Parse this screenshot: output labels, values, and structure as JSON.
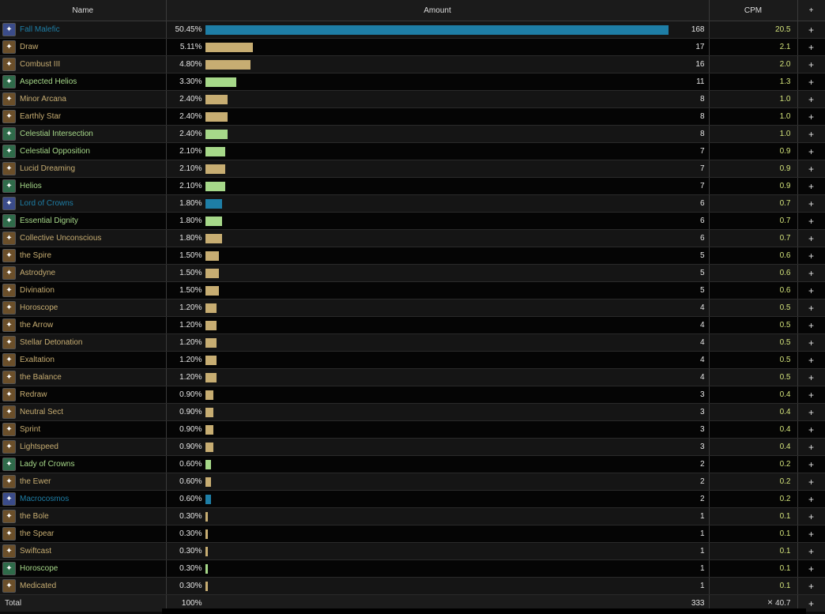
{
  "header": {
    "name": "Name",
    "amount": "Amount",
    "cpm": "CPM",
    "add": "+"
  },
  "colors": {
    "blue": "#1e7ea6",
    "tan": "#c7ad72",
    "green": "#a6d889",
    "cpm_text": "#d2e27a"
  },
  "rows": [
    {
      "name": "Fall Malefic",
      "pct": "50.45%",
      "frac": 0.9774,
      "count": "168",
      "cpm": "20.5",
      "color": "blue",
      "icon": "malefic-icon"
    },
    {
      "name": "Draw",
      "pct": "5.11%",
      "frac": 0.1012,
      "count": "17",
      "cpm": "2.1",
      "color": "tan",
      "icon": "draw-icon"
    },
    {
      "name": "Combust III",
      "pct": "4.80%",
      "frac": 0.0952,
      "count": "16",
      "cpm": "2.0",
      "color": "tan",
      "icon": "combust-icon"
    },
    {
      "name": "Aspected Helios",
      "pct": "3.30%",
      "frac": 0.0655,
      "count": "11",
      "cpm": "1.3",
      "color": "green",
      "icon": "helios-icon"
    },
    {
      "name": "Minor Arcana",
      "pct": "2.40%",
      "frac": 0.0476,
      "count": "8",
      "cpm": "1.0",
      "color": "tan",
      "icon": "arcana-icon"
    },
    {
      "name": "Earthly Star",
      "pct": "2.40%",
      "frac": 0.0476,
      "count": "8",
      "cpm": "1.0",
      "color": "tan",
      "icon": "star-icon"
    },
    {
      "name": "Celestial Intersection",
      "pct": "2.40%",
      "frac": 0.0476,
      "count": "8",
      "cpm": "1.0",
      "color": "green",
      "icon": "intersection-icon"
    },
    {
      "name": "Celestial Opposition",
      "pct": "2.10%",
      "frac": 0.0417,
      "count": "7",
      "cpm": "0.9",
      "color": "green",
      "icon": "opposition-icon"
    },
    {
      "name": "Lucid Dreaming",
      "pct": "2.10%",
      "frac": 0.0417,
      "count": "7",
      "cpm": "0.9",
      "color": "tan",
      "icon": "lucid-icon"
    },
    {
      "name": "Helios",
      "pct": "2.10%",
      "frac": 0.0417,
      "count": "7",
      "cpm": "0.9",
      "color": "green",
      "icon": "helios-icon"
    },
    {
      "name": "Lord of Crowns",
      "pct": "1.80%",
      "frac": 0.0357,
      "count": "6",
      "cpm": "0.7",
      "color": "blue",
      "icon": "crown-icon"
    },
    {
      "name": "Essential Dignity",
      "pct": "1.80%",
      "frac": 0.0357,
      "count": "6",
      "cpm": "0.7",
      "color": "green",
      "icon": "dignity-icon"
    },
    {
      "name": "Collective Unconscious",
      "pct": "1.80%",
      "frac": 0.0357,
      "count": "6",
      "cpm": "0.7",
      "color": "tan",
      "icon": "collective-icon"
    },
    {
      "name": "the Spire",
      "pct": "1.50%",
      "frac": 0.0298,
      "count": "5",
      "cpm": "0.6",
      "color": "tan",
      "icon": "spire-icon"
    },
    {
      "name": "Astrodyne",
      "pct": "1.50%",
      "frac": 0.0298,
      "count": "5",
      "cpm": "0.6",
      "color": "tan",
      "icon": "astrodyne-icon"
    },
    {
      "name": "Divination",
      "pct": "1.50%",
      "frac": 0.0298,
      "count": "5",
      "cpm": "0.6",
      "color": "tan",
      "icon": "divination-icon"
    },
    {
      "name": "Horoscope",
      "pct": "1.20%",
      "frac": 0.0238,
      "count": "4",
      "cpm": "0.5",
      "color": "tan",
      "icon": "horoscope-icon"
    },
    {
      "name": "the Arrow",
      "pct": "1.20%",
      "frac": 0.0238,
      "count": "4",
      "cpm": "0.5",
      "color": "tan",
      "icon": "arrow-icon"
    },
    {
      "name": "Stellar Detonation",
      "pct": "1.20%",
      "frac": 0.0238,
      "count": "4",
      "cpm": "0.5",
      "color": "tan",
      "icon": "detonation-icon"
    },
    {
      "name": "Exaltation",
      "pct": "1.20%",
      "frac": 0.0238,
      "count": "4",
      "cpm": "0.5",
      "color": "tan",
      "icon": "exaltation-icon"
    },
    {
      "name": "the Balance",
      "pct": "1.20%",
      "frac": 0.0238,
      "count": "4",
      "cpm": "0.5",
      "color": "tan",
      "icon": "balance-icon"
    },
    {
      "name": "Redraw",
      "pct": "0.90%",
      "frac": 0.0179,
      "count": "3",
      "cpm": "0.4",
      "color": "tan",
      "icon": "redraw-icon"
    },
    {
      "name": "Neutral Sect",
      "pct": "0.90%",
      "frac": 0.0179,
      "count": "3",
      "cpm": "0.4",
      "color": "tan",
      "icon": "sect-icon"
    },
    {
      "name": "Sprint",
      "pct": "0.90%",
      "frac": 0.0179,
      "count": "3",
      "cpm": "0.4",
      "color": "tan",
      "icon": "sprint-icon"
    },
    {
      "name": "Lightspeed",
      "pct": "0.90%",
      "frac": 0.0179,
      "count": "3",
      "cpm": "0.4",
      "color": "tan",
      "icon": "lightspeed-icon"
    },
    {
      "name": "Lady of Crowns",
      "pct": "0.60%",
      "frac": 0.0119,
      "count": "2",
      "cpm": "0.2",
      "color": "green",
      "icon": "lady-icon"
    },
    {
      "name": "the Ewer",
      "pct": "0.60%",
      "frac": 0.0119,
      "count": "2",
      "cpm": "0.2",
      "color": "tan",
      "icon": "ewer-icon"
    },
    {
      "name": "Macrocosmos",
      "pct": "0.60%",
      "frac": 0.0119,
      "count": "2",
      "cpm": "0.2",
      "color": "blue",
      "icon": "macrocosmos-icon"
    },
    {
      "name": "the Bole",
      "pct": "0.30%",
      "frac": 0.006,
      "count": "1",
      "cpm": "0.1",
      "color": "tan",
      "icon": "bole-icon"
    },
    {
      "name": "the Spear",
      "pct": "0.30%",
      "frac": 0.006,
      "count": "1",
      "cpm": "0.1",
      "color": "tan",
      "icon": "spear-icon"
    },
    {
      "name": "Swiftcast",
      "pct": "0.30%",
      "frac": 0.006,
      "count": "1",
      "cpm": "0.1",
      "color": "tan",
      "icon": "swiftcast-icon"
    },
    {
      "name": "Horoscope",
      "pct": "0.30%",
      "frac": 0.006,
      "count": "1",
      "cpm": "0.1",
      "color": "green",
      "icon": "horoscope-icon"
    },
    {
      "name": "Medicated",
      "pct": "0.30%",
      "frac": 0.006,
      "count": "1",
      "cpm": "0.1",
      "color": "tan",
      "icon": "potion-icon"
    }
  ],
  "total": {
    "label": "Total",
    "pct": "100%",
    "count": "333",
    "cpm": "40.7",
    "add": "+"
  },
  "footer": {
    "close": "×"
  }
}
